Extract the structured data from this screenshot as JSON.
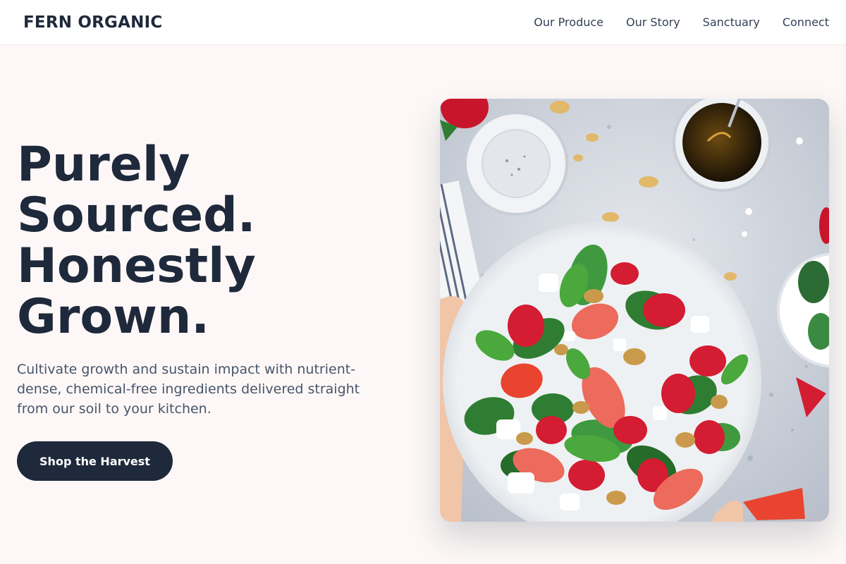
{
  "header": {
    "logo": "FERN ORGANIC",
    "nav": [
      {
        "label": "Our Produce"
      },
      {
        "label": "Our Story"
      },
      {
        "label": "Sanctuary"
      },
      {
        "label": "Connect"
      }
    ]
  },
  "hero": {
    "title_lines": [
      "Purely",
      "Sourced.",
      "Honestly",
      "Grown."
    ],
    "subtitle": "Cultivate growth and sustain impact with nutrient-dense, chemical-free ingredients delivered straight from our soil to your kitchen.",
    "cta_label": "Shop the Harvest",
    "image": {
      "subject": "bowl-of-strawberry-spinach-salad",
      "accent_colors": {
        "background": "#fdf8f7",
        "text": "#1e293b",
        "muted_text": "#475569",
        "button": "#1e293b"
      }
    }
  }
}
